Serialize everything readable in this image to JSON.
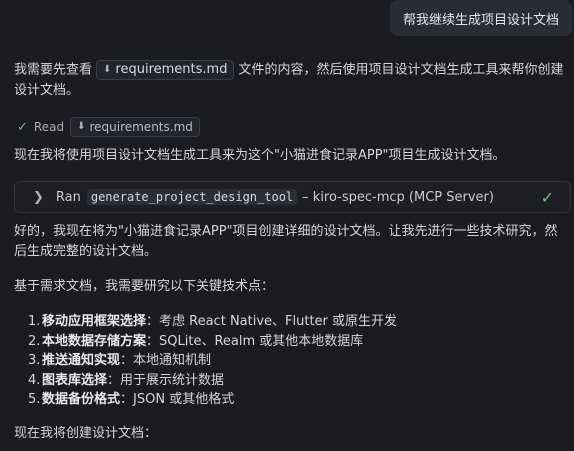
{
  "user_message": "帮我继续生成项目设计文档",
  "intro": {
    "before": "我需要先查看",
    "file": "requirements.md",
    "after": "文件的内容，然后使用项目设计文档生成工具来帮你创建设计文档。"
  },
  "read_step": {
    "label": "Read",
    "file": "requirements.md"
  },
  "line_after_read": "现在我将使用项目设计文档生成工具来为这个\"小猫进食记录APP\"项目生成设计文档。",
  "tool_call": {
    "ran_label": "Ran",
    "tool_name": "generate_project_design_tool",
    "server": "– kiro-spec-mcp (MCP Server)"
  },
  "response_para": "好的，我现在将为\"小猫进食记录APP\"项目创建详细的设计文档。让我先进行一些技术研究，然后生成完整的设计文档。",
  "research_intro": "基于需求文档，我需要研究以下关键技术点：",
  "research_items": [
    {
      "num": "1.",
      "title": "移动应用框架选择",
      "desc": "：考虑 React Native、Flutter 或原生开发"
    },
    {
      "num": "2.",
      "title": "本地数据存储方案",
      "desc": "：SQLite、Realm 或其他本地数据库"
    },
    {
      "num": "3.",
      "title": "推送通知实现",
      "desc": "：本地通知机制"
    },
    {
      "num": "4.",
      "title": "图表库选择",
      "desc": "：用于展示统计数据"
    },
    {
      "num": "5.",
      "title": "数据备份格式",
      "desc": "：JSON 或其他格式"
    }
  ],
  "final_line": "现在我将创建设计文档：",
  "icons": {
    "file": "download-arrow-icon",
    "read_check": "check-icon",
    "chevron": "chevron-right-icon",
    "tool_check": "check-icon"
  },
  "colors": {
    "background": "#1b1c21",
    "accent_green": "#66c27a"
  }
}
